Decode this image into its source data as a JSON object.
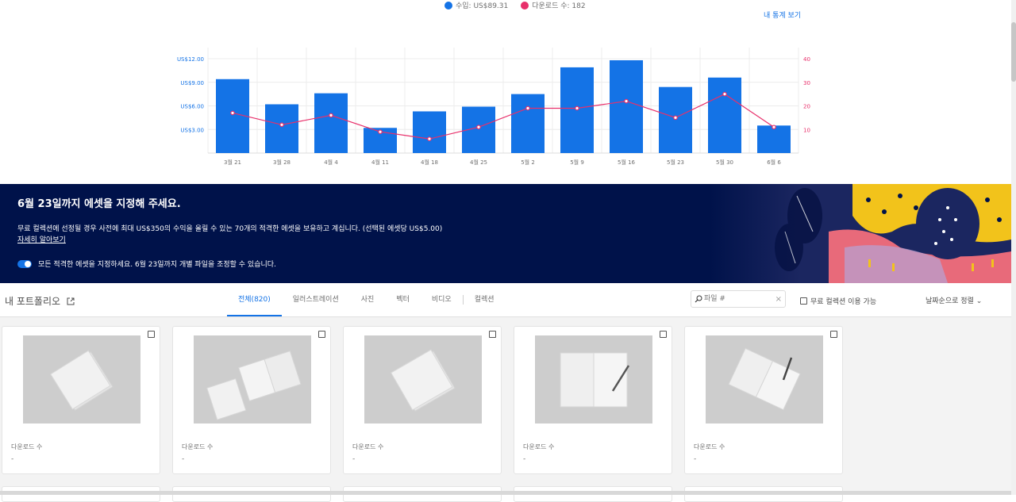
{
  "legend": {
    "revenue": "수입: US$89.31",
    "downloads": "다운로드 수: 182"
  },
  "stats_link": "내 통계 보기",
  "colors": {
    "revenue": "#1473e6",
    "downloads": "#e8306b",
    "banner_bg": "#00124a",
    "accent": "#1473e6"
  },
  "chart_data": {
    "type": "bar",
    "categories": [
      "3월 21",
      "3월 28",
      "4월 4",
      "4월 11",
      "4월 18",
      "4월 25",
      "5월 2",
      "5월 9",
      "5월 16",
      "5월 23",
      "5월 30",
      "6월 6"
    ],
    "series": [
      {
        "name": "수입",
        "type": "bar",
        "axis": "left",
        "values": [
          9.4,
          6.2,
          7.6,
          3.2,
          5.3,
          5.9,
          7.5,
          10.9,
          11.8,
          8.4,
          9.6,
          3.5
        ]
      },
      {
        "name": "다운로드 수",
        "type": "line",
        "axis": "right",
        "values": [
          17,
          12,
          16,
          9,
          6,
          11,
          19,
          19,
          22,
          15,
          25,
          11
        ]
      }
    ],
    "y_left": {
      "ticks": [
        "US$3.00",
        "US$6.00",
        "US$9.00",
        "US$12.00"
      ],
      "tick_values": [
        3,
        6,
        9,
        12
      ],
      "range": [
        0,
        12
      ]
    },
    "y_right": {
      "ticks": [
        "10",
        "20",
        "30",
        "40"
      ],
      "tick_values": [
        10,
        20,
        30,
        40
      ],
      "range": [
        0,
        40
      ]
    },
    "grid": true
  },
  "banner": {
    "title": "6월 23일까지 에셋을 지정해 주세요.",
    "description": "무료 컬렉션에 선정될 경우 사전에 최대 US$350의 수익을 올릴 수 있는 70개의 적격한 에셋을 보유하고 계십니다. (선택된 에셋당 US$5.00)",
    "more_link": "자세히 알아보기",
    "toggle_label": "모든 적격한 에셋을 지정하세요. 6월 23일까지 개별 파일을 조정할 수 있습니다."
  },
  "toolbar": {
    "title": "내 포트폴리오",
    "tabs": [
      "전체(820)",
      "일러스트레이션",
      "사진",
      "벡터",
      "비디오",
      "컬렉션"
    ],
    "search_placeholder": "파일 #",
    "free_collection_label": "무료 컬렉션 이용 가능",
    "sort_label": "날짜순으로 정렬"
  },
  "cards": [
    {
      "download_label": "다운로드 수",
      "download_value": "-"
    },
    {
      "download_label": "다운로드 수",
      "download_value": "-"
    },
    {
      "download_label": "다운로드 수",
      "download_value": "-"
    },
    {
      "download_label": "다운로드 수",
      "download_value": "-"
    },
    {
      "download_label": "다운로드 수",
      "download_value": "-"
    }
  ]
}
